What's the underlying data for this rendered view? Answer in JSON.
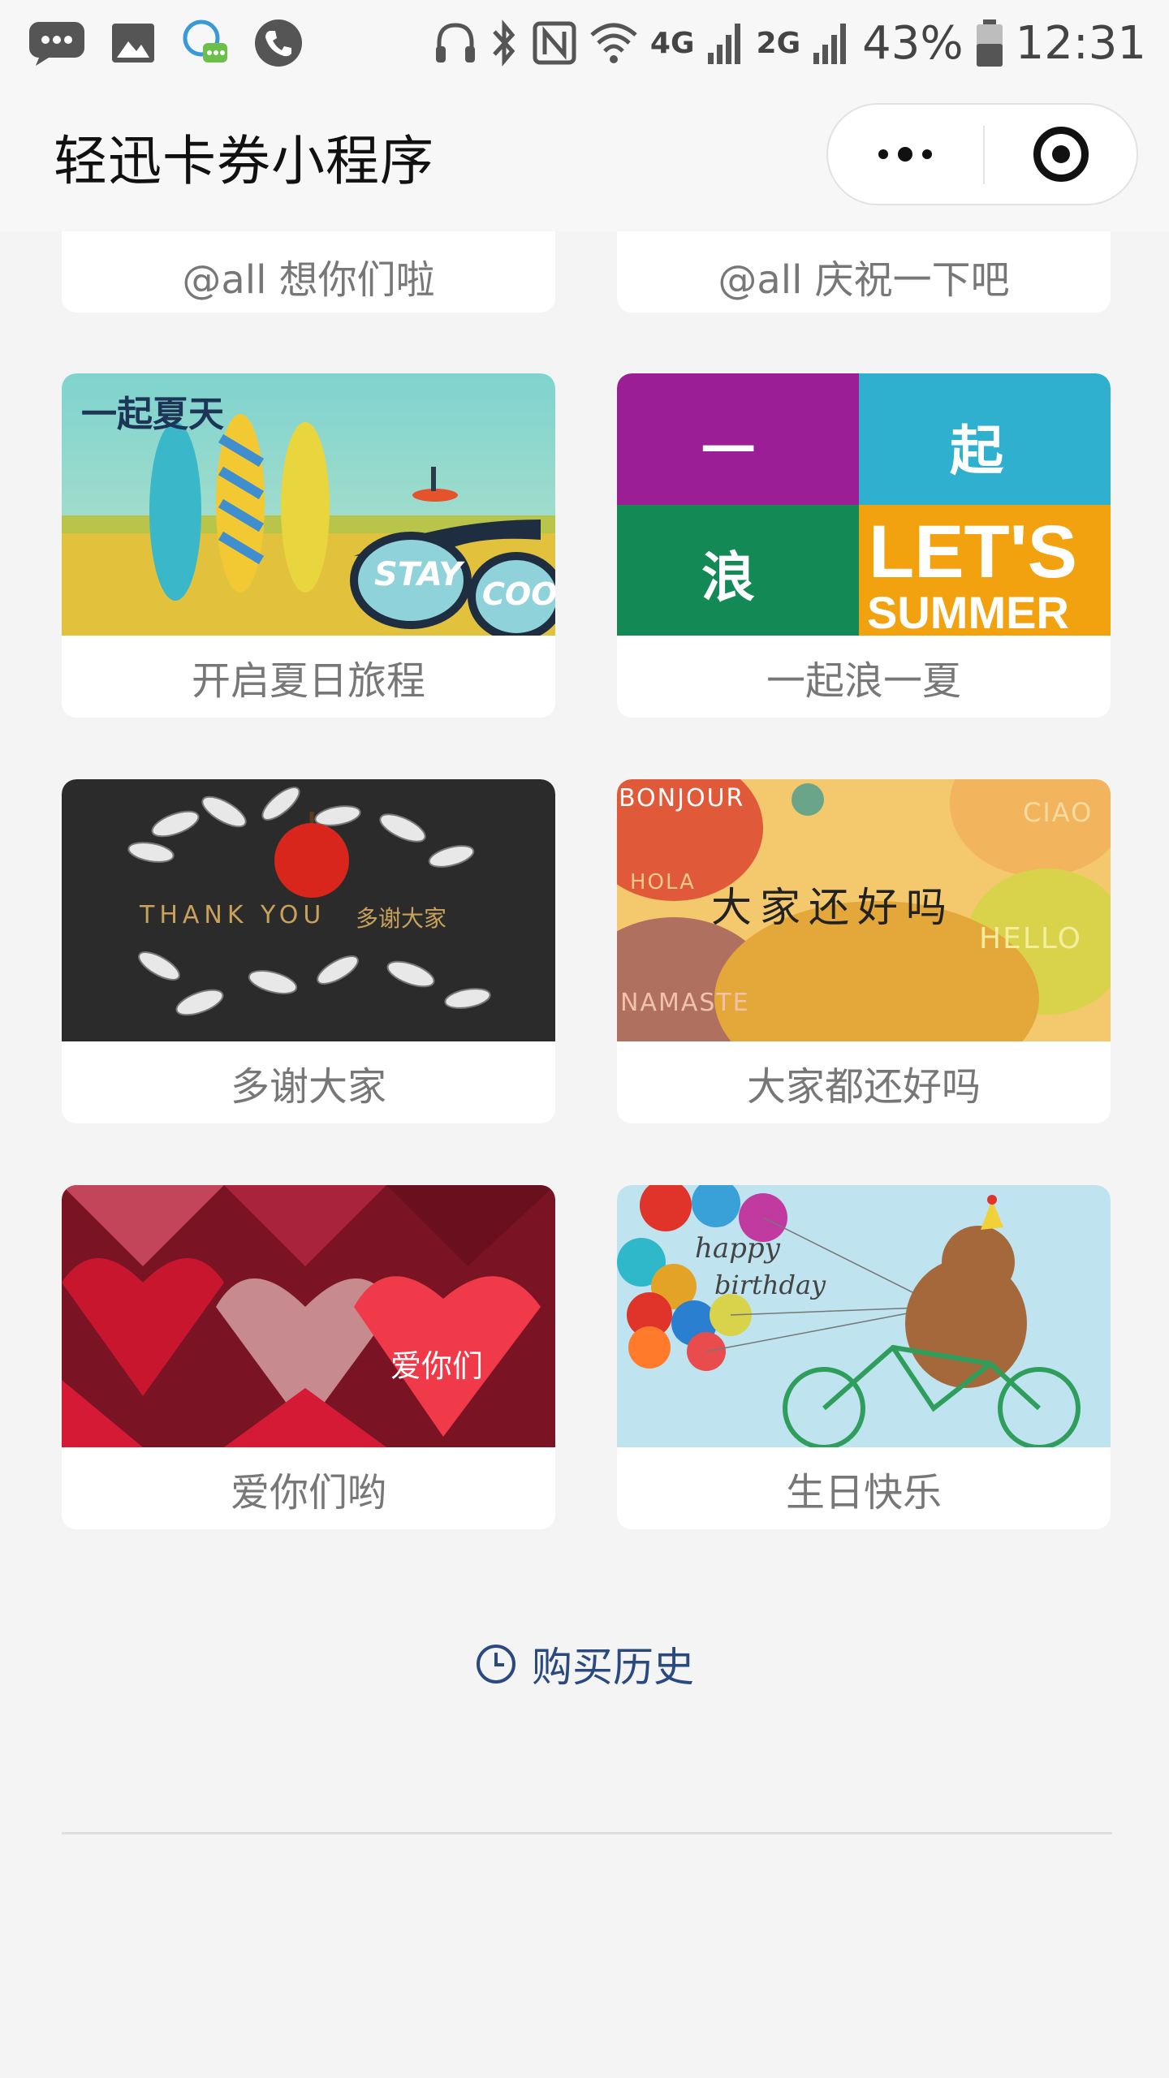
{
  "status_bar": {
    "battery_percent": "43%",
    "time": "12:31",
    "network_4g": "4G",
    "network_2g": "2G",
    "icons": [
      "message-icon",
      "gallery-icon",
      "qq-icon",
      "phone-icon",
      "headphones-icon",
      "bluetooth-icon",
      "nfc-icon",
      "wifi-icon",
      "signal-icon",
      "battery-icon"
    ]
  },
  "nav": {
    "title": "轻迅卡券小程序"
  },
  "cards": [
    {
      "caption": "@all 想你们啦"
    },
    {
      "caption": "@all 庆祝一下吧"
    },
    {
      "caption": "开启夏日旅程",
      "image_text": [
        "一起夏天",
        "STAY",
        "COOL"
      ]
    },
    {
      "caption": "一起浪一夏",
      "image_text": [
        "一",
        "起",
        "浪",
        "LET'S",
        "SUMMER"
      ]
    },
    {
      "caption": "多谢大家",
      "image_text": [
        "THANK YOU",
        "多谢大家"
      ]
    },
    {
      "caption": "大家都还好吗",
      "image_text": [
        "BONJOUR",
        "CIAO",
        "HOLA",
        "大家还好吗",
        "HELLO",
        "NAMASTE"
      ]
    },
    {
      "caption": "爱你们哟",
      "image_text": [
        "爱你们"
      ]
    },
    {
      "caption": "生日快乐",
      "image_text": [
        "happy",
        "birthday"
      ]
    }
  ],
  "history": {
    "label": "购买历史"
  },
  "colors": {
    "background": "#f4f4f4",
    "link": "#2a4a7f",
    "caption": "#777777"
  }
}
